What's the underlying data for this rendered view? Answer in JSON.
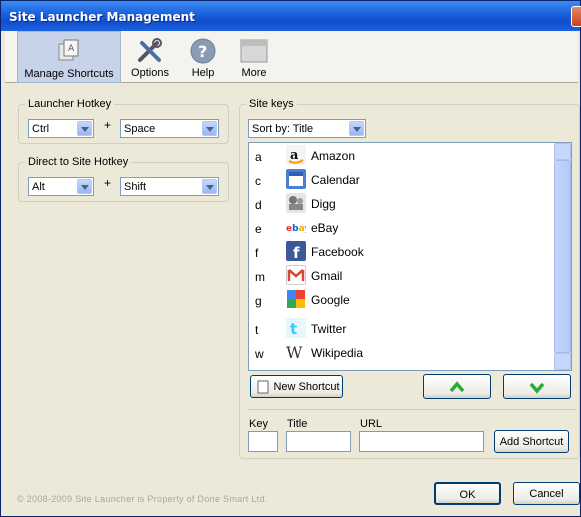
{
  "window": {
    "title": "Site Launcher Management"
  },
  "toolbar": {
    "items": [
      {
        "label": "Manage Shortcuts",
        "icon": "manage-shortcuts-icon"
      },
      {
        "label": "Options",
        "icon": "tools-icon"
      },
      {
        "label": "Help",
        "icon": "help-icon"
      },
      {
        "label": "More",
        "icon": "more-icon"
      }
    ]
  },
  "launcher_hotkey": {
    "legend": "Launcher Hotkey",
    "modifier": "Ctrl",
    "plus": "+",
    "key": "Space"
  },
  "direct_hotkey": {
    "legend": "Direct to Site Hotkey",
    "modifier": "Alt",
    "plus": "+",
    "key": "Shift"
  },
  "site_keys": {
    "legend": "Site keys",
    "sort": "Sort by: Title",
    "rows": [
      {
        "key": "a",
        "name": "Amazon",
        "icon": "amazon-icon",
        "color": "#ff9900"
      },
      {
        "key": "c",
        "name": "Calendar",
        "icon": "calendar-icon",
        "color": "#4a7fd8"
      },
      {
        "key": "d",
        "name": "Digg",
        "icon": "digg-icon",
        "color": "#7a7a7a"
      },
      {
        "key": "e",
        "name": "eBay",
        "icon": "ebay-icon",
        "color": "#e53238"
      },
      {
        "key": "f",
        "name": "Facebook",
        "icon": "facebook-icon",
        "color": "#3b5998"
      },
      {
        "key": "m",
        "name": "Gmail",
        "icon": "gmail-icon",
        "color": "#d14836"
      },
      {
        "key": "g",
        "name": "Google",
        "icon": "google-icon",
        "color": "#4285f4"
      },
      {
        "key": "t",
        "name": "Twitter",
        "icon": "twitter-icon",
        "color": "#33ccff"
      },
      {
        "key": "w",
        "name": "Wikipedia",
        "icon": "wikipedia-icon",
        "color": "#333333"
      },
      {
        "key": "",
        "name": "",
        "icon": "youtube-icon",
        "color": "#cc0000"
      }
    ],
    "new_shortcut": "New Shortcut",
    "move_up": "move-up-icon",
    "move_down": "move-down-icon"
  },
  "form": {
    "key_label": "Key",
    "title_label": "Title",
    "url_label": "URL",
    "key_value": "",
    "title_value": "",
    "url_value": "",
    "add_button": "Add Shortcut"
  },
  "footer": {
    "copyright": "© 2008-2009 Site Launcher is Property of Done Smart Ltd.",
    "ok": "OK",
    "cancel": "Cancel"
  }
}
